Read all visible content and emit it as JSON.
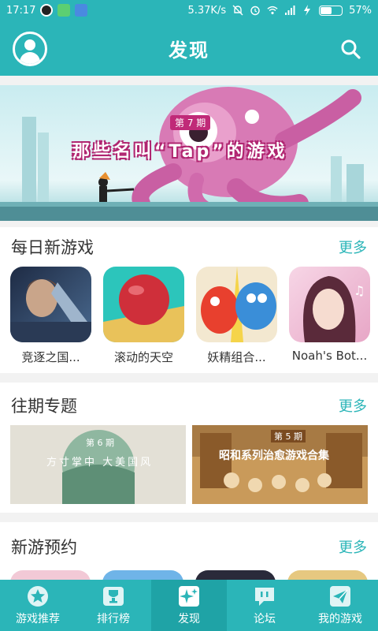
{
  "status_bar": {
    "time": "17:17",
    "speed": "5.37K/s",
    "battery": "57%",
    "battery_level": 0.57
  },
  "header": {
    "title": "发现"
  },
  "banner": {
    "issue": "第 7 期",
    "title": "那些名叫“Tap”的游戏"
  },
  "daily_new": {
    "title": "每日新游戏",
    "more": "更多",
    "games": [
      {
        "name": "竞逐之国..."
      },
      {
        "name": "滚动的天空"
      },
      {
        "name": "妖精组合..."
      },
      {
        "name": "Noah's Bot..."
      }
    ]
  },
  "past_topics": {
    "title": "往期专题",
    "more": "更多",
    "topics": [
      {
        "issue": "第 6 期",
        "title": "方寸掌中 大美国风"
      },
      {
        "issue": "第 5 期",
        "title": "昭和系列治愈游戏合集"
      }
    ]
  },
  "preorder": {
    "title": "新游预约",
    "more": "更多"
  },
  "bottom_nav": [
    {
      "label": "游戏推荐",
      "icon": "star-icon"
    },
    {
      "label": "排行榜",
      "icon": "trophy-icon"
    },
    {
      "label": "发现",
      "icon": "sparkle-icon"
    },
    {
      "label": "论坛",
      "icon": "chat-icon"
    },
    {
      "label": "我的游戏",
      "icon": "send-icon"
    }
  ],
  "colors": {
    "brand": "#2bb5b8",
    "brand_dark": "#1fa3a6",
    "text": "#333333"
  }
}
